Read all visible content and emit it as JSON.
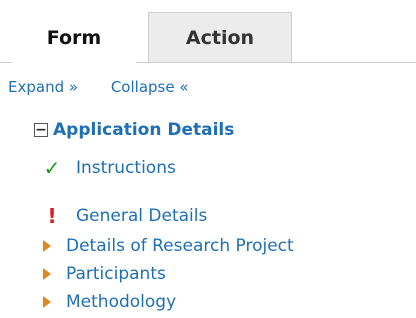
{
  "tabs": {
    "form": "Form",
    "action": "Action"
  },
  "links": {
    "expand": "Expand »",
    "collapse": "Collapse «"
  },
  "tree": {
    "root": {
      "label": "Application Details",
      "toggle": "−"
    },
    "items": [
      {
        "label": "Instructions",
        "status": "complete",
        "icon": "check-icon"
      },
      {
        "label": "General Details",
        "status": "error",
        "icon": "alert-icon"
      },
      {
        "label": "Details of Research Project",
        "status": "pending",
        "icon": "arrow-right-icon"
      },
      {
        "label": "Participants",
        "status": "pending",
        "icon": "arrow-right-icon"
      },
      {
        "label": "Methodology",
        "status": "pending",
        "icon": "arrow-right-icon"
      }
    ]
  },
  "icons": {
    "check": "✓",
    "alert": "!"
  },
  "colors": {
    "link": "#1f6fb5",
    "check": "#1a9a1a",
    "alert": "#d62020",
    "arrow": "#e08a1e"
  }
}
